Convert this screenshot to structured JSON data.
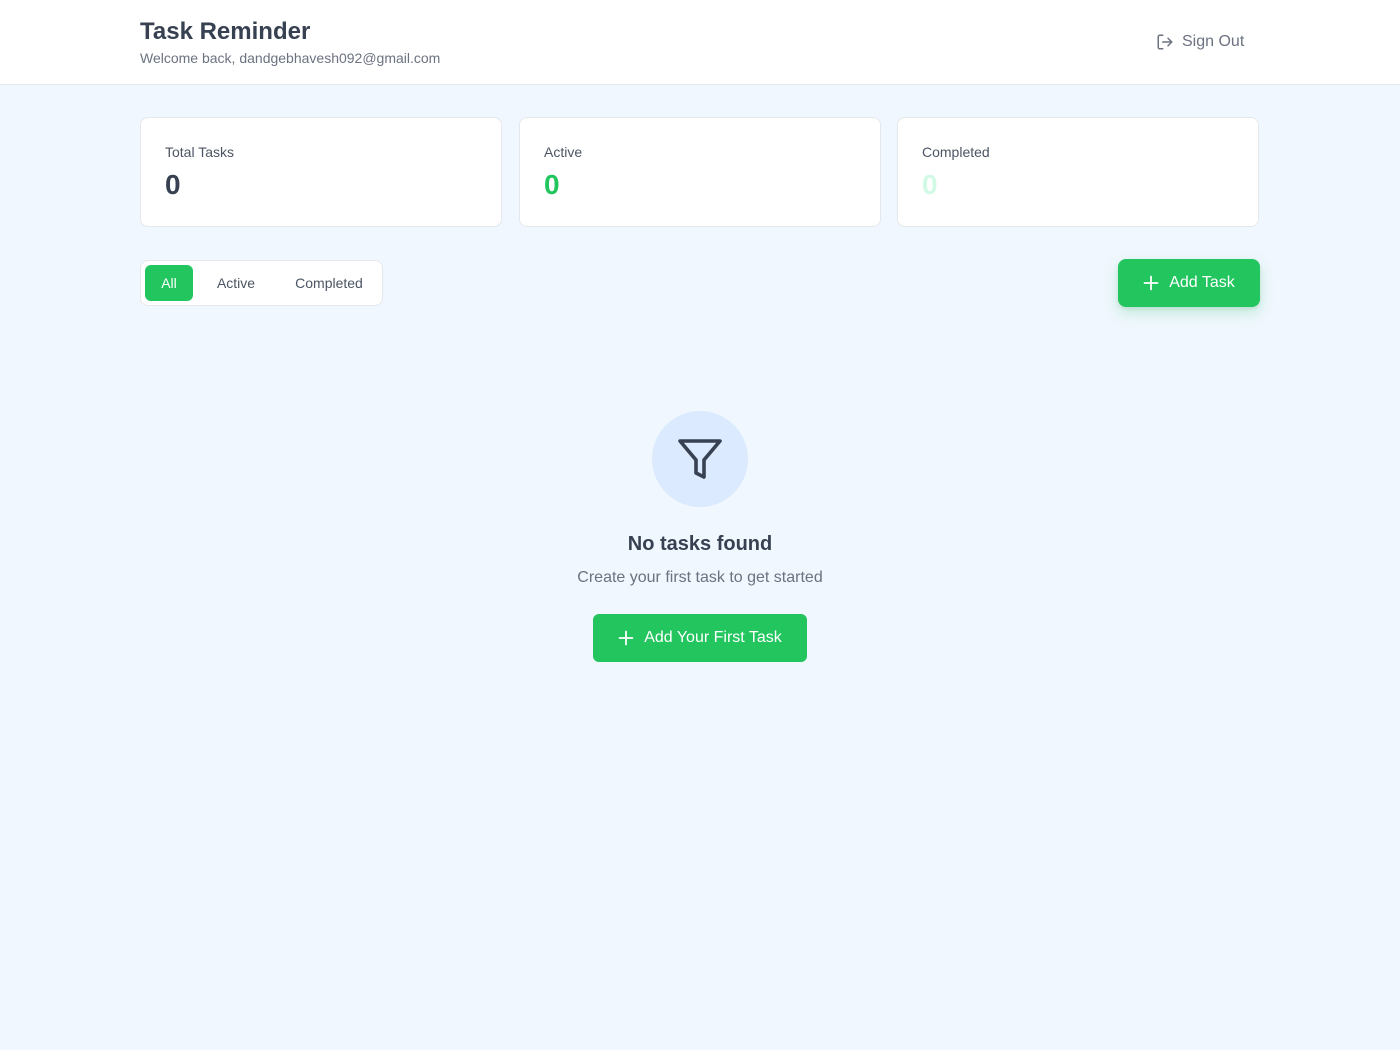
{
  "header": {
    "title": "Task Reminder",
    "welcome": "Welcome back, dandgebhavesh092@gmail.com",
    "signout_label": "Sign Out",
    "signout_icon": "logout-icon"
  },
  "stats": [
    {
      "label": "Total Tasks",
      "value": "0",
      "color": "#374151"
    },
    {
      "label": "Active",
      "value": "0",
      "color": "#22c55e"
    },
    {
      "label": "Completed",
      "value": "0",
      "color": "#d1fae5"
    }
  ],
  "filters": {
    "tabs": [
      "All",
      "Active",
      "Completed"
    ],
    "selected": "All"
  },
  "add_task": {
    "label": "Add Task",
    "icon": "plus-icon"
  },
  "empty_state": {
    "icon": "filter-icon",
    "title": "No tasks found",
    "subtitle": "Create your first task to get started",
    "button_label": "Add Your First Task",
    "button_icon": "plus-icon"
  },
  "colors": {
    "accent": "#22c55e",
    "background": "#f0f7fe",
    "icon_circle": "#dbeafe"
  }
}
